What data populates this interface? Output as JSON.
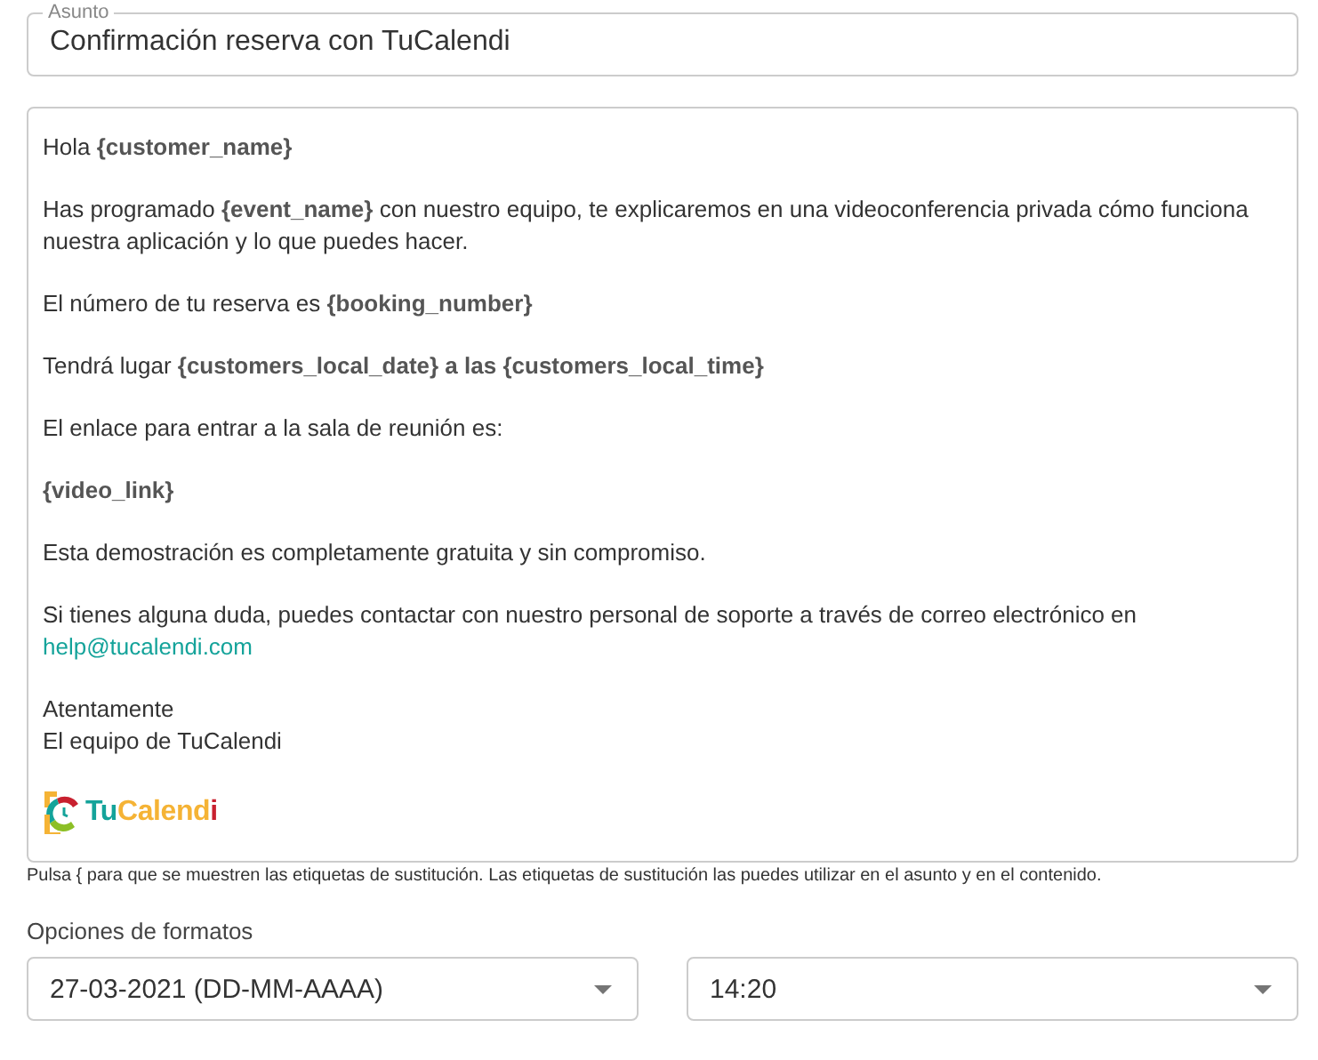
{
  "subject": {
    "label": "Asunto",
    "value": "Confirmación reserva con TuCalendi"
  },
  "body": {
    "paragraphs": [
      {
        "lines": [
          "Hola **{customer_name}**"
        ]
      },
      {
        "lines": [
          "Has programado **{event_name}** con nuestro equipo, te explicaremos en una videoconferencia privada cómo funciona nuestra aplicación y lo que puedes hacer."
        ]
      },
      {
        "lines": [
          "El número de tu reserva es **{booking_number}**"
        ]
      },
      {
        "lines": [
          "Tendrá lugar **{customers_local_date} a las {customers_local_time}**"
        ]
      },
      {
        "lines": [
          "El enlace para entrar a la sala de reunión es:"
        ]
      },
      {
        "lines": [
          "**{video_link}**"
        ]
      },
      {
        "lines": [
          "Esta demostración es completamente gratuita y sin compromiso."
        ]
      },
      {
        "lines": [
          "Si tienes alguna duda, puedes contactar con nuestro personal de soporte a través de correo electrónico en"
        ],
        "link": "help@tucalendi.com"
      },
      {
        "lines": [
          "Atentamente",
          "El equipo de TuCalendi"
        ]
      }
    ],
    "logo": [
      {
        "text": "Tu",
        "color": "#14a39a"
      },
      {
        "text": "Calend",
        "color": "#f5b335"
      },
      {
        "text": "i",
        "color": "#c8202f"
      }
    ]
  },
  "hint": "Pulsa { para que se muestren las etiquetas de sustitución. Las etiquetas de sustitución las puedes utilizar en el asunto y en el contenido.",
  "formats": {
    "label": "Opciones de formatos",
    "selects": [
      {
        "value": "27-03-2021 (DD-MM-AAAA)"
      },
      {
        "value": "14:20"
      }
    ]
  }
}
